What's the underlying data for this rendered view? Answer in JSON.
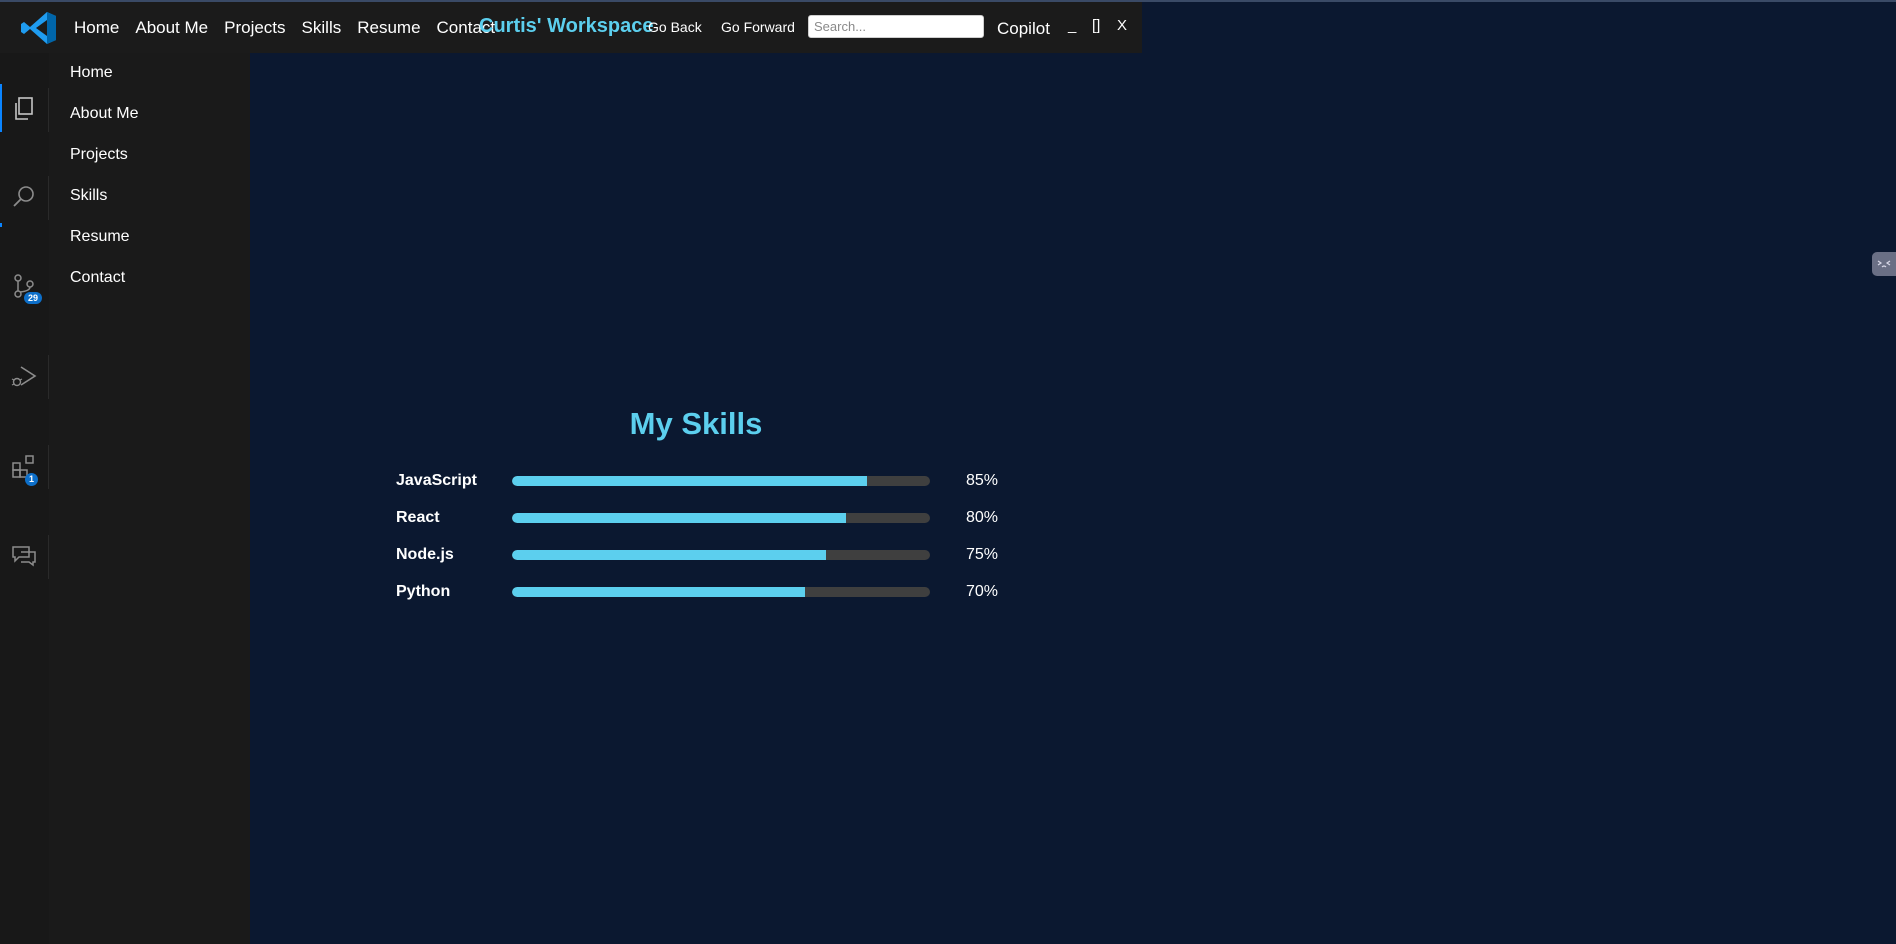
{
  "titlebar": {
    "nav": [
      "Home",
      "About Me",
      "Projects",
      "Skills",
      "Resume",
      "Contact"
    ],
    "brand": "Curtis' Workspace",
    "go_back": "Go Back",
    "go_forward": "Go Forward",
    "search_placeholder": "Search...",
    "copilot": "Copilot",
    "minimize": "_",
    "maximize": "[]",
    "close": "X"
  },
  "activity_bar": {
    "items": [
      {
        "icon": "explorer-icon",
        "active": true
      },
      {
        "icon": "search-icon"
      },
      {
        "icon": "source-control-icon",
        "badge": "29"
      },
      {
        "icon": "run-debug-icon"
      },
      {
        "icon": "extensions-icon",
        "badge": "1"
      },
      {
        "icon": "chat-icon"
      }
    ]
  },
  "sidebar": {
    "items": [
      "Home",
      "About Me",
      "Projects",
      "Skills",
      "Resume",
      "Contact"
    ]
  },
  "main": {
    "title": "My Skills",
    "skills": [
      {
        "name": "JavaScript",
        "percent_label": "85%",
        "level": 0.85
      },
      {
        "name": "React",
        "percent_label": "80%",
        "level": 0.8
      },
      {
        "name": "Node.js",
        "percent_label": "75%",
        "level": 0.75
      },
      {
        "name": "Python",
        "percent_label": "70%",
        "level": 0.7
      }
    ]
  },
  "colors": {
    "accent": "#5ccfee",
    "background": "#0b1830",
    "sidebar": "#1a1a1a",
    "titlebar": "#1b1b1b",
    "track": "#3f3f3f",
    "badge": "#0d6fc9"
  }
}
